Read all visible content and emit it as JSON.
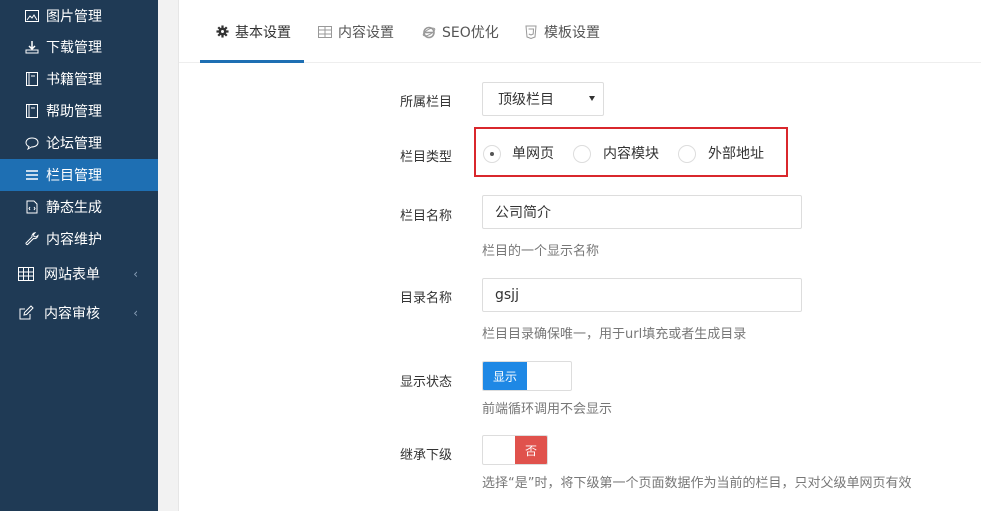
{
  "sidebar": {
    "sub_items": [
      {
        "label": "图片管理",
        "icon": "image-icon"
      },
      {
        "label": "下载管理",
        "icon": "download-icon"
      },
      {
        "label": "书籍管理",
        "icon": "book-icon"
      },
      {
        "label": "帮助管理",
        "icon": "book-icon"
      },
      {
        "label": "论坛管理",
        "icon": "comment-icon"
      },
      {
        "label": "栏目管理",
        "icon": "list-icon",
        "active": true
      },
      {
        "label": "静态生成",
        "icon": "file-code-icon"
      },
      {
        "label": "内容维护",
        "icon": "wrench-icon"
      }
    ],
    "groups": [
      {
        "label": "网站表单",
        "icon": "table-icon",
        "chevron": "‹"
      },
      {
        "label": "内容审核",
        "icon": "edit-icon",
        "chevron": "‹"
      }
    ]
  },
  "tabs": [
    {
      "label": "基本设置",
      "icon": "gear-icon",
      "active": true
    },
    {
      "label": "内容设置",
      "icon": "table-icon"
    },
    {
      "label": "SEO优化",
      "icon": "ie-icon"
    },
    {
      "label": "模板设置",
      "icon": "html5-icon"
    }
  ],
  "form": {
    "parent": {
      "label": "所属栏目",
      "value": "顶级栏目"
    },
    "type": {
      "label": "栏目类型",
      "options": [
        "单网页",
        "内容模块",
        "外部地址"
      ],
      "selected": "单网页"
    },
    "name": {
      "label": "栏目名称",
      "value": "公司简介",
      "help": "栏目的一个显示名称"
    },
    "dir": {
      "label": "目录名称",
      "value": "gsjj",
      "help": "栏目目录确保唯一，用于url填充或者生成目录"
    },
    "show": {
      "label": "显示状态",
      "switch_text": "显示",
      "state": "on",
      "help": "前端循环调用不会显示"
    },
    "inherit": {
      "label": "继承下级",
      "switch_text": "否",
      "state": "off",
      "help": "选择“是”时，将下级第一个页面数据作为当前的栏目，只对父级单网页有效"
    }
  },
  "colors": {
    "sidebar_bg": "#1f3a55",
    "active_item": "#1e6fb3",
    "switch_on": "#1e88e5",
    "switch_off": "#e0524c",
    "highlight": "#d9272c"
  }
}
